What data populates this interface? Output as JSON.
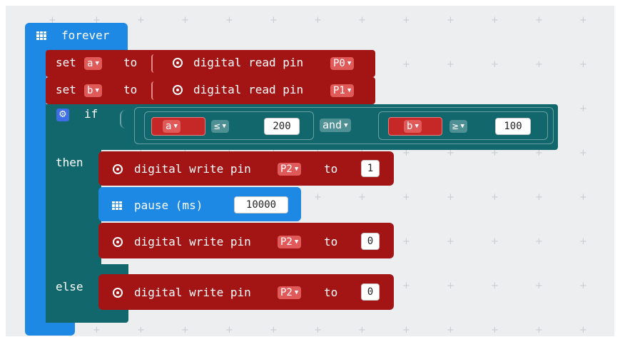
{
  "colors": {
    "forever": "#1e88e5",
    "pins": "#a31515",
    "pause": "#1e88e5",
    "logic": "#11676b",
    "var": "#c62828"
  },
  "forever": {
    "label": "forever",
    "icon": "grid-icon"
  },
  "set_a": {
    "set": "set",
    "var": "a",
    "to": "to",
    "read": "digital read pin",
    "pin": "P0"
  },
  "set_b": {
    "set": "set",
    "var": "b",
    "to": "to",
    "read": "digital read pin",
    "pin": "P1"
  },
  "if_block": {
    "if": "if",
    "then": "then",
    "else": "else",
    "cond1": {
      "var": "a",
      "op": "≤",
      "value": "200"
    },
    "and": "and",
    "cond2": {
      "var": "b",
      "op": "≥",
      "value": "100"
    }
  },
  "write1": {
    "label": "digital write pin",
    "pin": "P2",
    "to": "to",
    "value": "1"
  },
  "pause": {
    "label": "pause (ms)",
    "value": "10000"
  },
  "write2": {
    "label": "digital write pin",
    "pin": "P2",
    "to": "to",
    "value": "0"
  },
  "write3": {
    "label": "digital write pin",
    "pin": "P2",
    "to": "to",
    "value": "0"
  }
}
